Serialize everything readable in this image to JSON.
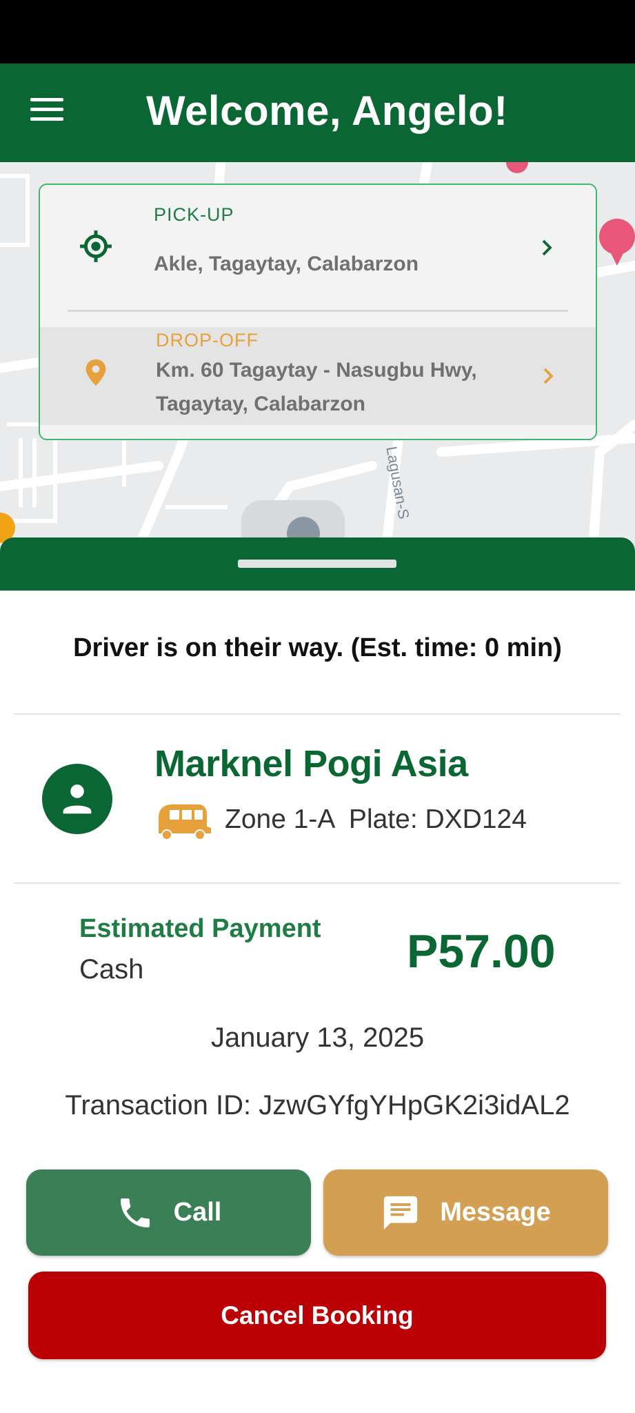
{
  "appbar": {
    "title": "Welcome, Angelo!"
  },
  "map": {
    "street_label": "Lagusan-S"
  },
  "pickup": {
    "label": "PICK-UP",
    "address": "Akle, Tagaytay, Calabarzon"
  },
  "dropoff": {
    "label": "DROP-OFF",
    "address_line1": "Km. 60 Tagaytay - Nasugbu Hwy,",
    "address_line2": "Tagaytay, Calabarzon"
  },
  "trip": {
    "status": "Driver is on their way. (Est. time: 0 min)"
  },
  "driver": {
    "name": "Marknel Pogi Asia",
    "zone_plate": "Zone 1-A  Plate: DXD124"
  },
  "payment": {
    "label": "Estimated Payment",
    "method": "Cash",
    "amount": "P57.00"
  },
  "booking": {
    "date": "January 13, 2025",
    "transaction": "Transaction ID: JzwGYfgYHpGK2i3idAL2"
  },
  "actions": {
    "call_label": "Call",
    "message_label": "Message",
    "cancel_label": "Cancel Booking"
  },
  "colors": {
    "primary": "#0a6632",
    "accent": "#d3a053",
    "danger": "#bb0005",
    "call": "#3b7f57"
  },
  "icons": {
    "menu": "menu-icon",
    "pickup": "crosshair-icon",
    "dropoff": "map-pin-icon",
    "chevron": "chevron-right-icon",
    "avatar": "person-icon",
    "vehicle": "tricycle-icon",
    "phone": "phone-icon",
    "message": "chat-icon"
  }
}
